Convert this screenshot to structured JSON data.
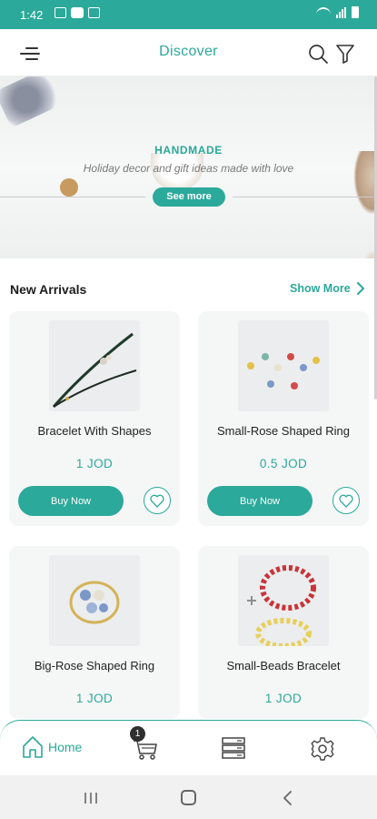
{
  "status_bar": {
    "time": "1:42"
  },
  "header": {
    "title": "Discover"
  },
  "banner": {
    "kicker": "HANDMADE",
    "tagline": "Holiday decor and gift ideas made with love",
    "cta_label": "See more"
  },
  "section": {
    "title": "New Arrivals",
    "show_more_label": "Show More"
  },
  "products": [
    {
      "name": "Bracelet With Shapes",
      "price": "1 JOD",
      "buy_label": "Buy Now"
    },
    {
      "name": "Small-Rose Shaped Ring",
      "price": "0.5  JOD",
      "buy_label": "Buy Now"
    },
    {
      "name": "Big-Rose Shaped Ring",
      "price": "1 JOD"
    },
    {
      "name": "Small-Beads Bracelet",
      "price": "1 JOD"
    }
  ],
  "bottom_nav": {
    "home_label": "Home",
    "cart_count": "1"
  },
  "colors": {
    "accent": "#2ba99a",
    "card_background": "#f5f6f6",
    "badge": "#2f2f2f"
  },
  "icons": [
    "menu-icon",
    "search-icon",
    "filter-icon",
    "chevron-right-icon",
    "heart-icon",
    "home-icon",
    "cart-icon",
    "server-list-icon",
    "settings-gear-icon"
  ]
}
